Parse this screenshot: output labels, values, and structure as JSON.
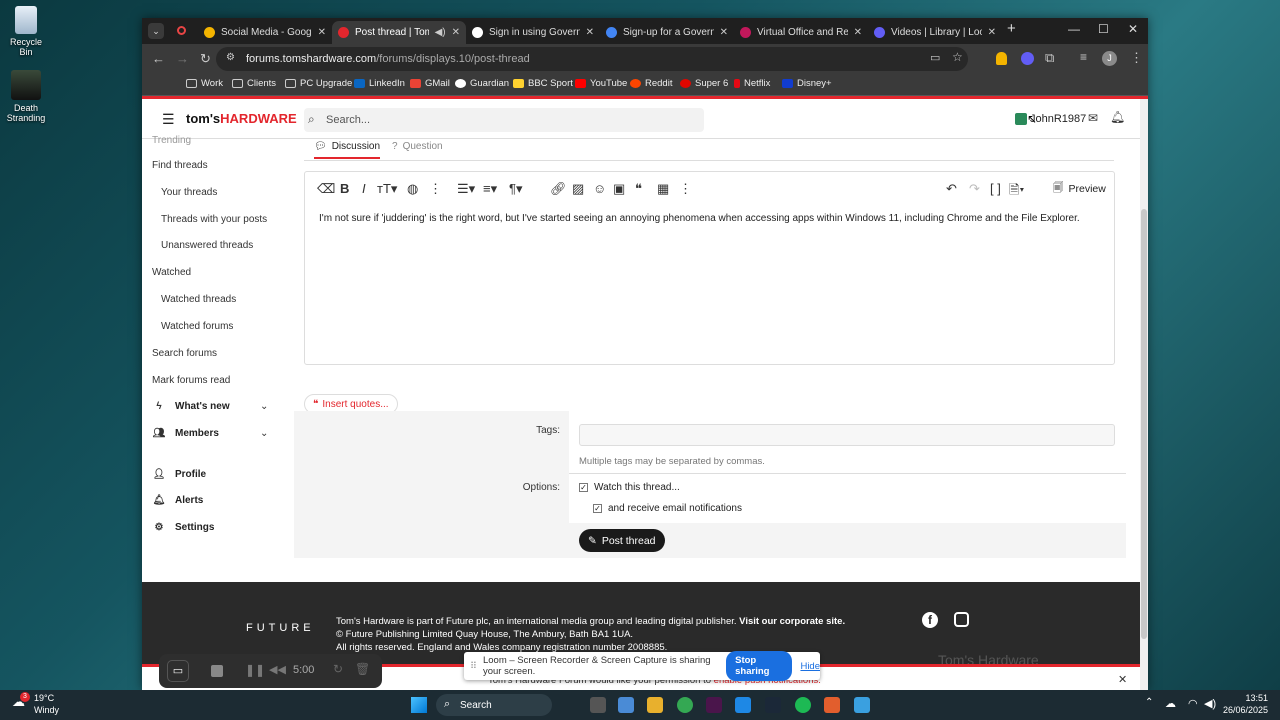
{
  "desktop": {
    "icons": [
      {
        "label": "Recycle Bin"
      },
      {
        "label": "Death Stranding"
      }
    ]
  },
  "browser": {
    "tabs": [
      {
        "label": "Social Media - Google D",
        "color": "#f4b400"
      },
      {
        "label": "Post thread | Tom's H",
        "color": "#e3262d"
      },
      {
        "label": "Sign in using Governme",
        "color": "#ffffff"
      },
      {
        "label": "Sign-up for a Governm",
        "color": "#4285f4"
      },
      {
        "label": "Virtual Office and Regis",
        "color": "#c2185b"
      },
      {
        "label": "Videos | Library | Loom",
        "color": "#625df5"
      }
    ],
    "url_host": "forums.tomshardware.com",
    "url_path": "/forums/displays.10/post-thread",
    "bookmarks": [
      {
        "label": "Work",
        "color": "#888"
      },
      {
        "label": "Clients",
        "color": "#888"
      },
      {
        "label": "PC Upgrade",
        "color": "#888"
      },
      {
        "label": "LinkedIn",
        "color": "#0a66c2"
      },
      {
        "label": "GMail",
        "color": "#ea4335"
      },
      {
        "label": "Guardian",
        "color": "#052962"
      },
      {
        "label": "BBC Sport",
        "color": "#ffd230"
      },
      {
        "label": "YouTube",
        "color": "#ff0000"
      },
      {
        "label": "Reddit",
        "color": "#ff4500"
      },
      {
        "label": "Super 6",
        "color": "#e10600"
      },
      {
        "label": "Netflix",
        "color": "#e50914"
      },
      {
        "label": "Disney+",
        "color": "#113ccf"
      }
    ]
  },
  "site": {
    "logo_prefix": "tom's",
    "logo_suffix": "HARDWARE",
    "search_placeholder": "Search...",
    "username": "JohnR1987"
  },
  "sidebar": {
    "items": [
      {
        "label": "Trending"
      },
      {
        "label": "Find threads"
      },
      {
        "label": "Your threads"
      },
      {
        "label": "Threads with your posts"
      },
      {
        "label": "Unanswered threads"
      },
      {
        "label": "Watched"
      },
      {
        "label": "Watched threads"
      },
      {
        "label": "Watched forums"
      },
      {
        "label": "Search forums"
      },
      {
        "label": "Mark forums read"
      },
      {
        "label": "What's new"
      },
      {
        "label": "Members"
      },
      {
        "label": "Profile"
      },
      {
        "label": "Alerts"
      },
      {
        "label": "Settings"
      }
    ]
  },
  "thread": {
    "tab_discussion": "Discussion",
    "tab_question": "Question",
    "preview_label": "Preview",
    "body": "I'm not sure if 'juddering' is the right word, but I've started seeing an annoying phenomena when accessing apps within Windows 11, including Chrome and the File Explorer.",
    "insert_quotes": "Insert quotes...",
    "tags_label": "Tags:",
    "tags_hint": "Multiple tags may be separated by commas.",
    "options_label": "Options:",
    "watch_label": "Watch this thread...",
    "email_label": "and receive email notifications",
    "post_button": "Post thread"
  },
  "footer": {
    "future": "FUTURE",
    "line1": "Tom's Hardware is part of Future plc, an international media group and leading digital publisher.",
    "line1_link": "Visit our corporate site.",
    "line2": "© Future Publishing Limited Quay House, The Ambury, Bath BA1 1UA.",
    "line3": "All rights reserved. England and Wales company registration number 2008885.",
    "watermark": "Tom's Hardware",
    "notif_text": "Tom's Hardware Forum would like your permission to",
    "notif_link": "enable push notifications."
  },
  "loom": {
    "timer": "5:00",
    "sharing_text": "Loom – Screen Recorder & Screen Capture is sharing your screen.",
    "stop_label": "Stop sharing",
    "hide_label": "Hide"
  },
  "taskbar": {
    "weather_temp": "19°C",
    "weather_desc": "Windy",
    "search_label": "Search",
    "time": "13:51",
    "date": "26/06/2025",
    "badge": "3"
  }
}
